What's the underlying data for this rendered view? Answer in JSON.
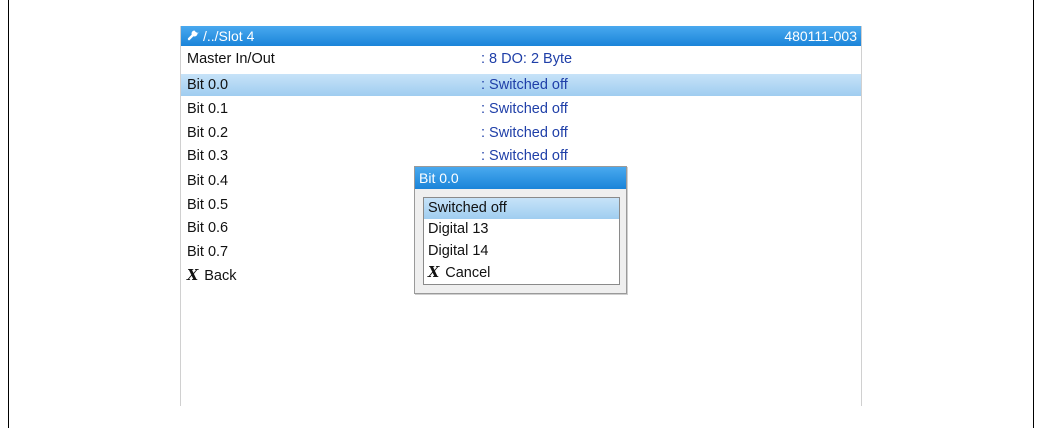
{
  "title": {
    "path": "/../Slot 4",
    "code": "480111-003"
  },
  "rows": [
    {
      "label": "Master In/Out",
      "value": ": 8 DO: 2 Byte"
    },
    {
      "label": "Bit 0.0",
      "value": ": Switched off"
    },
    {
      "label": "Bit 0.1",
      "value": ": Switched off"
    },
    {
      "label": "Bit 0.2",
      "value": ": Switched off"
    },
    {
      "label": "Bit 0.3",
      "value": ": Switched off"
    },
    {
      "label": "Bit 0.4",
      "value": ""
    },
    {
      "label": "Bit 0.5",
      "value": ""
    },
    {
      "label": "Bit 0.6",
      "value": ""
    },
    {
      "label": "Bit 0.7",
      "value": ""
    }
  ],
  "back": {
    "glyph": "X",
    "label": "Back"
  },
  "popup": {
    "title": "Bit 0.0",
    "options": [
      {
        "label": "Switched off"
      },
      {
        "label": "Digital 13"
      },
      {
        "label": "Digital 14"
      }
    ],
    "cancel": {
      "glyph": "X",
      "label": "Cancel"
    }
  },
  "colors": {
    "titlebar": "#1a84d9",
    "selection": "#9fcdf0",
    "value_text": "#1f3fa8"
  },
  "icons": {
    "title": "wrench-icon"
  }
}
